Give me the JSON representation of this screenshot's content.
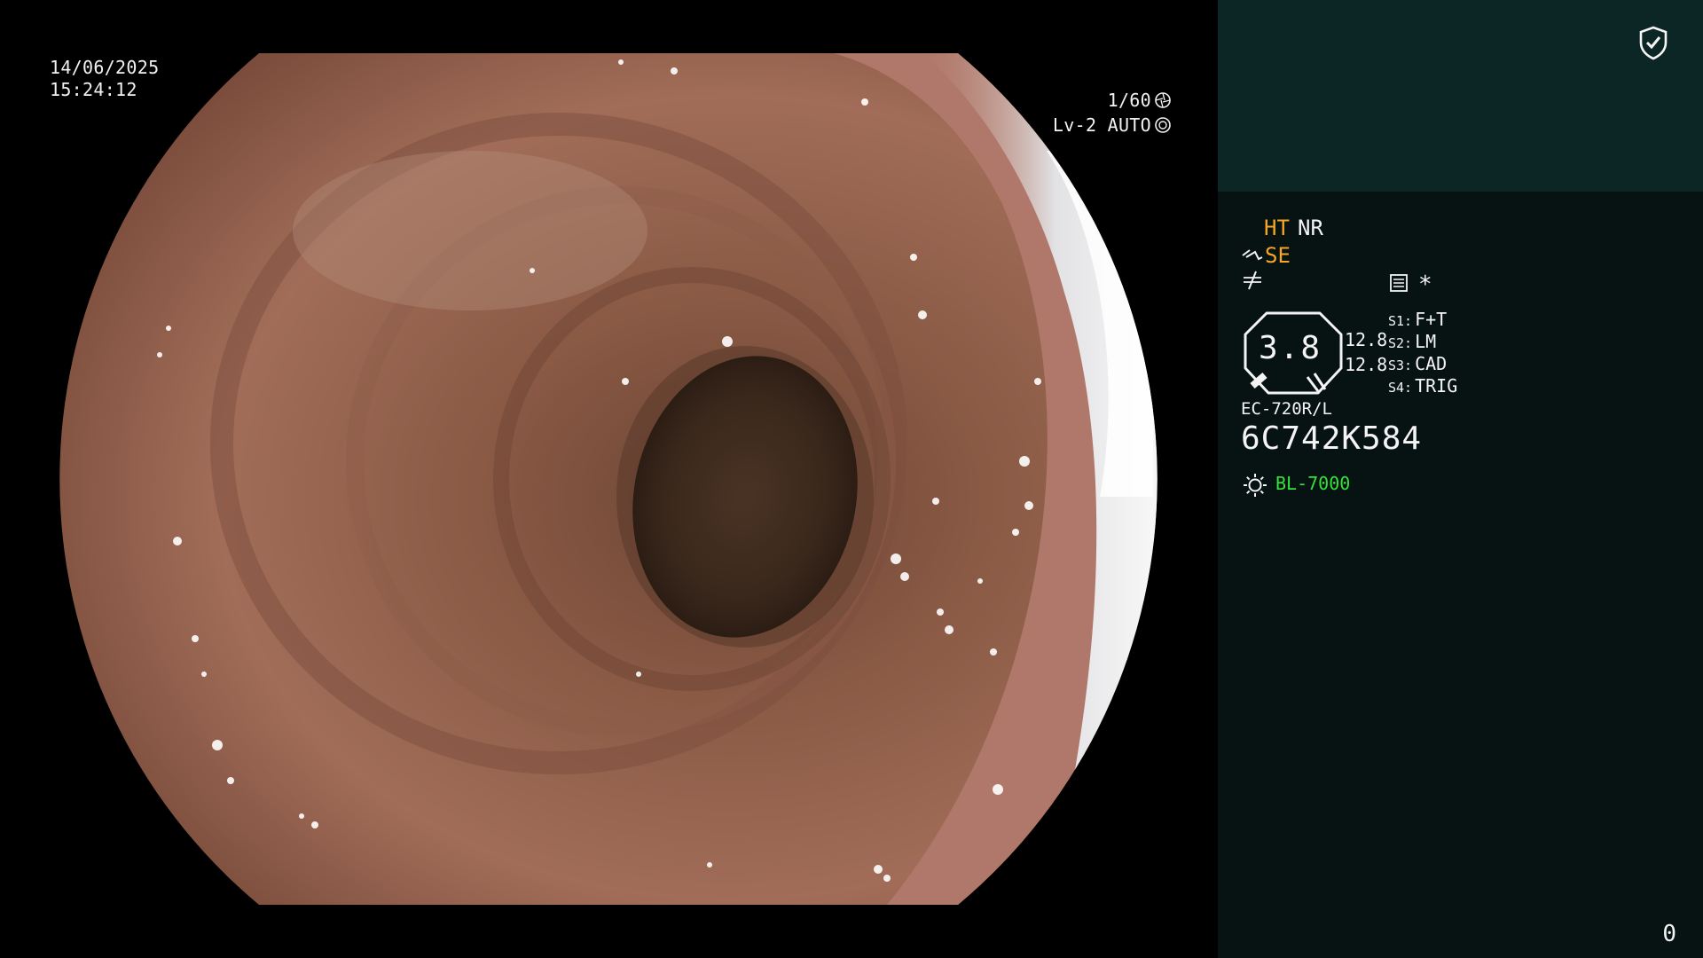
{
  "osd": {
    "date": "14/06/2025",
    "time": "15:24:12",
    "shutter": "1/60",
    "level": "Lv-2 AUTO",
    "icons": [
      "shutter-icon",
      "auto-iris-icon"
    ]
  },
  "panel": {
    "ht": "HT",
    "nr": "NR",
    "se": "SE",
    "star": "*",
    "gauge_value": "3.8",
    "value_a": "12.8",
    "value_b": "12.8",
    "slots": [
      {
        "key": "S1:",
        "label": "F+T"
      },
      {
        "key": "S2:",
        "label": "LM"
      },
      {
        "key": "S3:",
        "label": "CAD"
      },
      {
        "key": "S4:",
        "label": "TRIG"
      }
    ],
    "scope_model": "EC-720R/L",
    "scope_serial": "6C742K584",
    "light_source": "BL-7000",
    "counter": "0",
    "icons": [
      "shield-check-icon",
      "structure-enhance-icon",
      "slash-icon",
      "menu-icon",
      "gauge-icon",
      "light-source-icon"
    ]
  },
  "colors": {
    "panel_bg": "#071312",
    "panel_top_bg": "#0c2626",
    "accent_orange": "#f5a623",
    "accent_green": "#33e23a"
  }
}
